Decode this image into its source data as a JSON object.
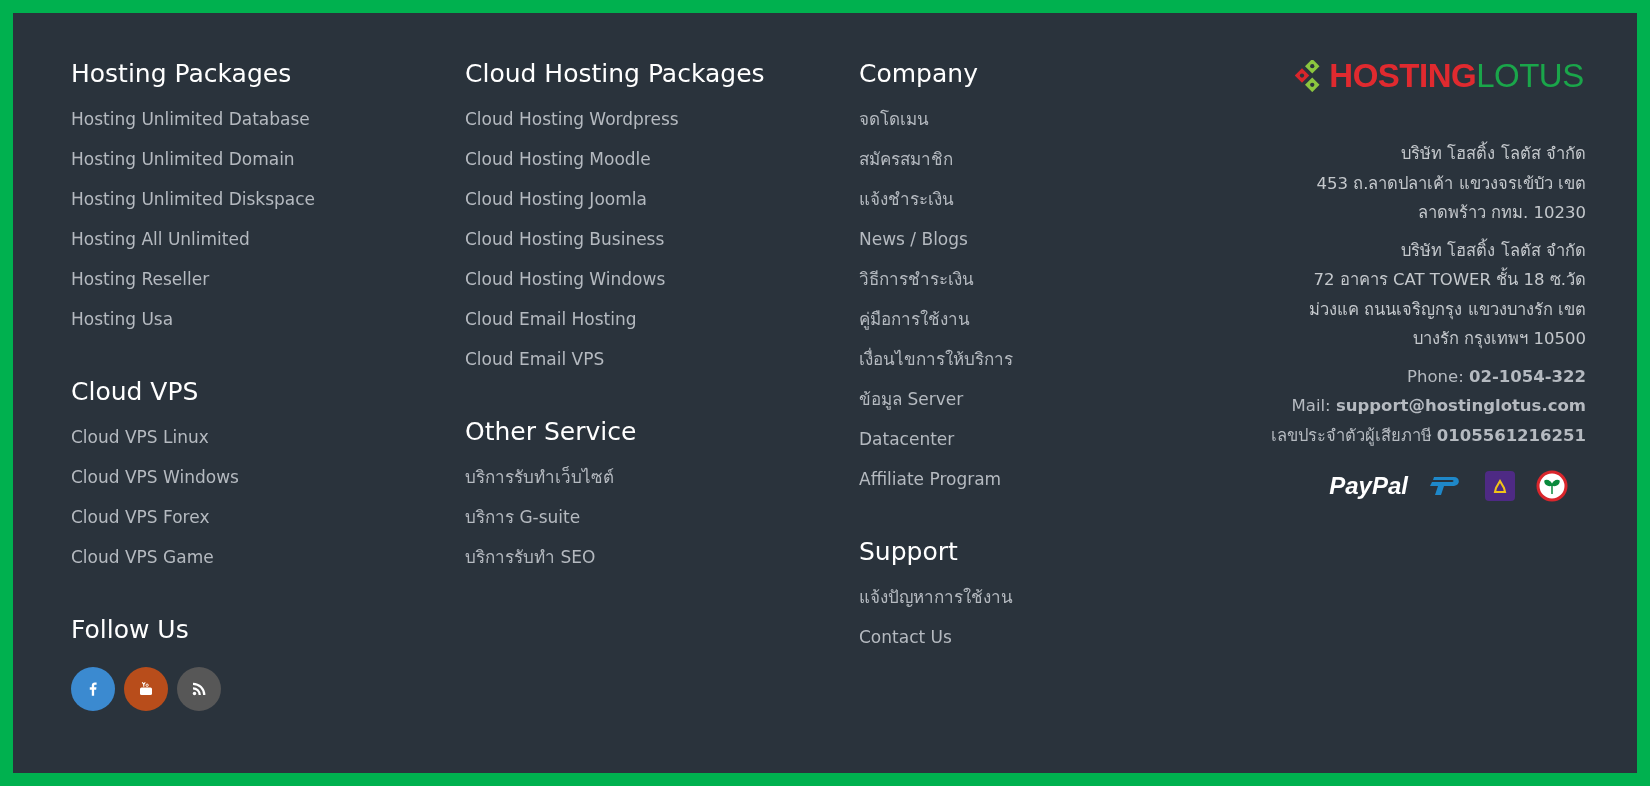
{
  "columns": [
    {
      "sections": [
        {
          "heading": "Hosting Packages",
          "links": [
            "Hosting Unlimited Database",
            "Hosting Unlimited Domain",
            "Hosting Unlimited Diskspace",
            "Hosting All Unlimited",
            "Hosting Reseller",
            "Hosting Usa"
          ]
        },
        {
          "heading": "Cloud VPS",
          "links": [
            "Cloud VPS Linux",
            "Cloud VPS Windows",
            "Cloud VPS Forex",
            "Cloud VPS Game"
          ]
        },
        {
          "heading": "Follow Us",
          "social": [
            {
              "kind": "facebook"
            },
            {
              "kind": "youtube"
            },
            {
              "kind": "rss"
            }
          ]
        }
      ]
    },
    {
      "sections": [
        {
          "heading": "Cloud Hosting Packages",
          "links": [
            "Cloud Hosting Wordpress",
            "Cloud Hosting Moodle",
            "Cloud Hosting Joomla",
            "Cloud Hosting Business",
            "Cloud Hosting Windows",
            "Cloud Email Hosting",
            "Cloud Email VPS"
          ]
        },
        {
          "heading": "Other Service",
          "links": [
            "บริการรับทำเว็บไซต์",
            "บริการ G-suite",
            "บริการรับทำ SEO"
          ]
        }
      ]
    },
    {
      "sections": [
        {
          "heading": "Company",
          "links": [
            "จดโดเมน",
            "สมัครสมาชิก",
            "แจ้งชำระเงิน",
            "News / Blogs",
            "วิธีการชำระเงิน",
            "คู่มือการใช้งาน",
            "เงื่อนไขการให้บริการ",
            "ข้อมูล Server",
            "Datacenter",
            "Affiliate Program"
          ]
        },
        {
          "heading": "Support",
          "links": [
            "แจ้งปัญหาการใช้งาน",
            "Contact Us"
          ]
        }
      ]
    }
  ],
  "company": {
    "logo": {
      "part1": "HOSTING",
      "part2": "LOTUS"
    },
    "addresses": [
      [
        "บริษัท โฮสติ้ง โลตัส จำกัด",
        "453 ถ.ลาดปลาเค้า แขวงจรเข้บัว เขต",
        "ลาดพร้าว กทม. 10230"
      ],
      [
        "บริษัท โฮสติ้ง โลตัส จำกัด",
        "72 อาคาร CAT TOWER ชั้น 18 ซ.วัด",
        "ม่วงแค ถนนเจริญกรุง แขวงบางรัก เขต",
        "บางรัก กรุงเทพฯ 10500"
      ]
    ],
    "contacts": [
      "Phone: **02-1054-322**",
      "Mail: **support@hostinglotus.com**",
      "เลขประจำตัวผู้เสียภาษี **0105561216251**"
    ],
    "payments": [
      {
        "kind": "paypal",
        "text": "PayPal"
      },
      {
        "kind": "p-logo"
      },
      {
        "kind": "bank-purple"
      },
      {
        "kind": "bank-green"
      }
    ]
  }
}
